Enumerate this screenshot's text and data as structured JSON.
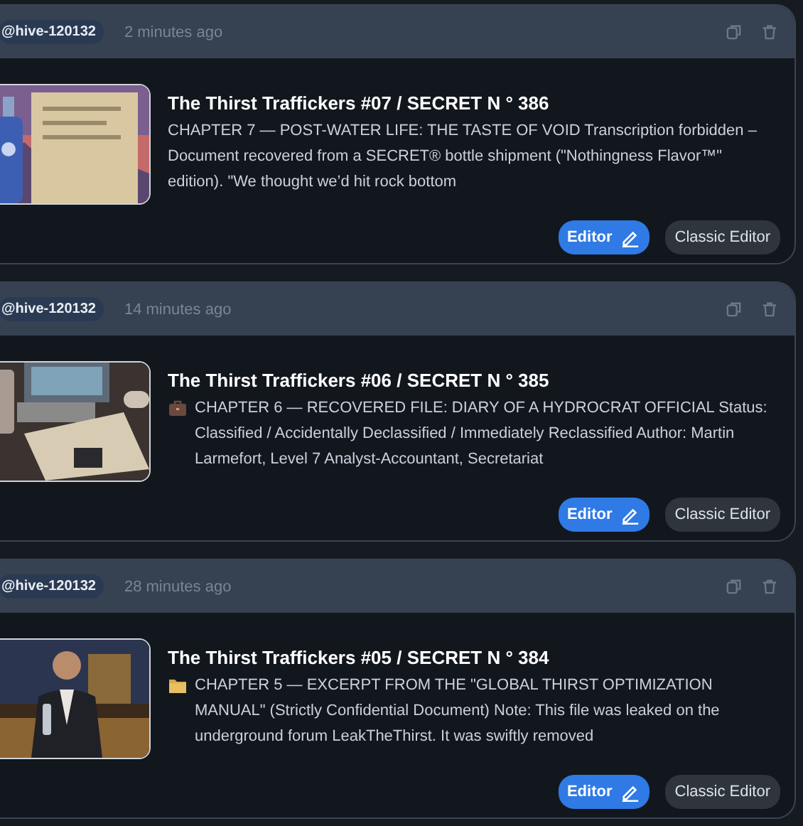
{
  "posts": [
    {
      "community": "@hive-120132",
      "time": "2 minutes ago",
      "kind": "plain",
      "title": "The Thirst Traffickers #07 / SECRET N ° 386",
      "excerpt": "CHAPTER 7 — POST-WATER LIFE: THE TASTE OF VOID Transcription forbidden – Document recovered from a SECRET® bottle shipment (\"Nothingness Flavor™\" edition). \"We thought we’d hit rock bottom",
      "buttons": [
        "Editor",
        "Classic Editor"
      ]
    },
    {
      "community": "@hive-120132",
      "time": "14 minutes ago",
      "kind": "briefcase",
      "title": "The Thirst Traffickers #06 / SECRET N ° 385",
      "excerpt": "CHAPTER 6 — RECOVERED FILE: DIARY OF A HYDROCRAT OFFICIAL Status: Classified / Accidentally Declassified / Immediately Reclassified Author: Martin Larmefort, Level 7 Analyst-Accountant, Secretariat",
      "buttons": [
        "Editor",
        "Classic Editor"
      ]
    },
    {
      "community": "@hive-120132",
      "time": "28 minutes ago",
      "kind": "folder",
      "title": "The Thirst Traffickers #05 / SECRET N ° 384",
      "excerpt": "CHAPTER 5 — EXCERPT FROM THE \"GLOBAL THIRST OPTIMIZATION MANUAL\" (Strictly Confidential Document) Note: This file was leaked on the underground forum LeakTheThirst. It was swiftly removed",
      "buttons": [
        "Editor",
        "Classic Editor"
      ]
    }
  ]
}
